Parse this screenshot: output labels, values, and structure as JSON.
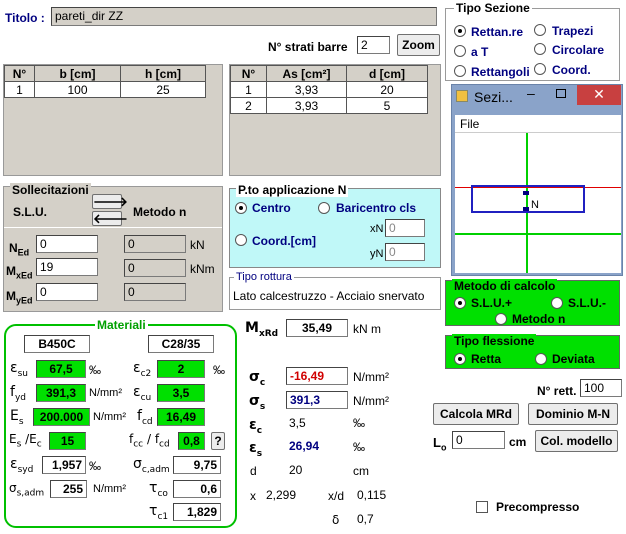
{
  "title": {
    "label": "Titolo :",
    "value": "pareti_dir ZZ"
  },
  "strati": {
    "label": "N° strati barre",
    "value": "2",
    "zoom": "Zoom"
  },
  "tipo_sezione": {
    "title": "Tipo Sezione",
    "options": [
      "Rettan.re",
      "Trapezi",
      "a T",
      "Circolare",
      "Rettangoli",
      "Coord."
    ]
  },
  "table_conc": {
    "headers": [
      "N°",
      "b [cm]",
      "h [cm]"
    ],
    "rows": [
      [
        "1",
        "100",
        "25"
      ]
    ]
  },
  "table_bars": {
    "headers": [
      "N°",
      "As [cm²]",
      "d [cm]"
    ],
    "rows": [
      [
        "1",
        "3,93",
        "20"
      ],
      [
        "2",
        "3,93",
        "5"
      ]
    ]
  },
  "sez_window": {
    "title": "Sezi...",
    "menu": "File",
    "point_label": "N"
  },
  "sollecitazioni": {
    "title": "Sollecitazioni",
    "slu": "S.L.U.",
    "metodo": "Metodo n",
    "n_label": "N",
    "n_sub": "Ed",
    "mx_label": "M",
    "mx_sub": "xEd",
    "my_label": "M",
    "my_sub": "yEd",
    "n_val": "0",
    "mx_val": "19",
    "my_val": "0",
    "n_out": "0",
    "mx_out": "0",
    "my_out": "0",
    "unit_kn": "kN",
    "unit_knm": "kNm"
  },
  "applicazione": {
    "title": "P.to applicazione N",
    "centro": "Centro",
    "baricentro": "Baricentro cls",
    "coord": "Coord.[cm]",
    "xn": "xN",
    "yn": "yN",
    "xn_val": "0",
    "yn_val": "0"
  },
  "rottura": {
    "title": "Tipo rottura",
    "value": "Lato calcestruzzo - Acciaio snervato"
  },
  "metodo_calcolo": {
    "title": "Metodo di calcolo",
    "slu_plus": "S.L.U.+",
    "slu_minus": "S.L.U.-",
    "metodo_n": "Metodo n"
  },
  "tipo_flessione": {
    "title": "Tipo flessione",
    "retta": "Retta",
    "deviata": "Deviata"
  },
  "materiali": {
    "title": "Materiali",
    "steel": "B450C",
    "concrete": "C28/35",
    "esu": "67,5",
    "esu_unit": "‰",
    "fyd": "391,3",
    "fyd_unit": "N/mm²",
    "es": "200.000",
    "es_unit": "N/mm²",
    "es_ec": "15",
    "esyd": "1,957",
    "esyd_unit": "‰",
    "sadm": "255",
    "sadm_unit": "N/mm²",
    "ec2": "2",
    "ec2_unit": "‰",
    "ecu": "3,5",
    "fcd": "16,49",
    "fcc_fcd": "0,8",
    "help": "?",
    "scadm": "9,75",
    "tco": "0,6",
    "tc1": "1,829"
  },
  "results": {
    "mxrd": "35,49",
    "mxrd_unit": "kN m",
    "sc": "-16,49",
    "sc_unit": "N/mm²",
    "ss": "391,3",
    "ss_unit": "N/mm²",
    "ec": "3,5",
    "ec_unit": "‰",
    "es": "26,94",
    "es_unit": "‰",
    "d_label": "d",
    "d": "20",
    "d_unit": "cm",
    "x_label": "x",
    "x": "2,299",
    "xd_label": "x/d",
    "xd": "0,115",
    "delta": "0,7"
  },
  "buttons": {
    "calcola": "Calcola MRd",
    "dominio": "Dominio M-N",
    "col_modello": "Col. modello"
  },
  "nrett": {
    "label": "N° rett.",
    "value": "100"
  },
  "lo": {
    "label": "L",
    "sub": "o",
    "value": "0",
    "unit": "cm"
  },
  "precompresso": "Precompresso"
}
